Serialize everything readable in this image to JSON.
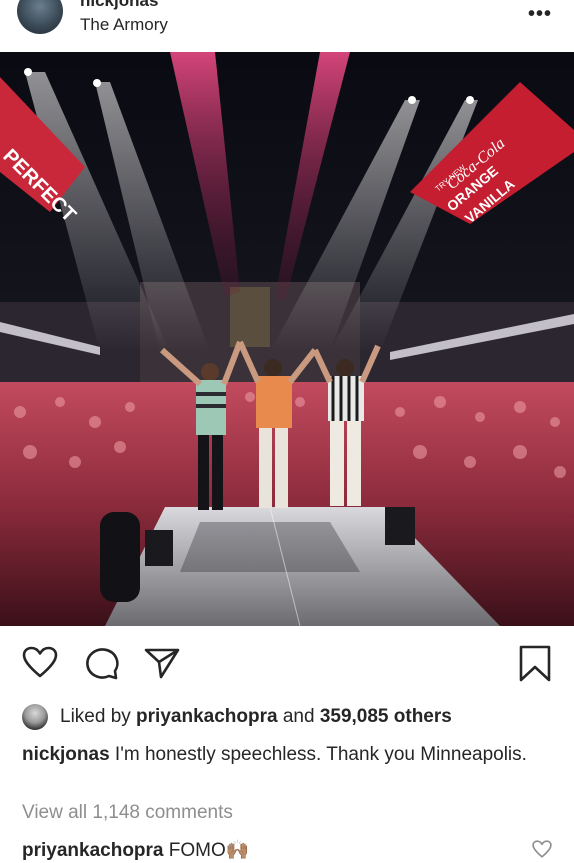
{
  "post": {
    "username": "nickjonas",
    "location": "The Armory",
    "more_label": "•••"
  },
  "photo": {
    "description_icon": "concert-stage-photo",
    "banner_left": "PERFECT",
    "banner_right_brand": "Coca-Cola",
    "banner_right_line1": "ORANGE",
    "banner_right_line2": "VANILLA",
    "banner_right_small": "TRY NEW"
  },
  "actions": {
    "like_icon": "heart-icon",
    "comment_icon": "comment-icon",
    "share_icon": "send-icon",
    "save_icon": "bookmark-icon"
  },
  "likes": {
    "prefix": "Liked by ",
    "user": "priyankachopra",
    "middle": " and ",
    "others": "359,085 others"
  },
  "caption": {
    "username": "nickjonas",
    "text": " I'm honestly speechless. Thank you Minneapolis."
  },
  "comments": {
    "view_all": "View all 1,148 comments",
    "first_user": "priyankachopra",
    "first_text": " FOMO🙌🏽"
  }
}
